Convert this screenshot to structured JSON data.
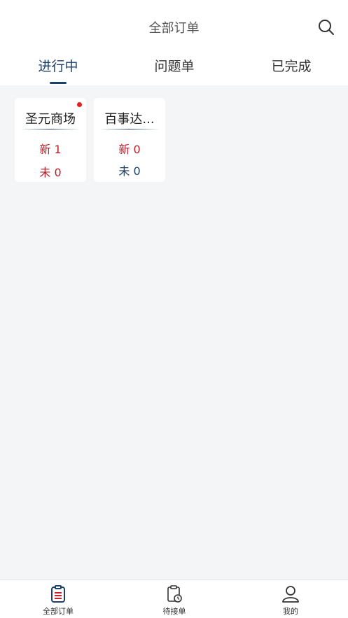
{
  "header": {
    "title": "全部订单"
  },
  "tabs": [
    {
      "label": "进行中"
    },
    {
      "label": "问题单"
    },
    {
      "label": "已完成"
    }
  ],
  "stores": [
    {
      "name": "圣元商场",
      "new_label": "新 1",
      "pending_label": "未 0",
      "has_dot": true,
      "pending_color": "#b8202a"
    },
    {
      "name": "百事达...",
      "new_label": "新 0",
      "pending_label": "未 0",
      "has_dot": false,
      "pending_color": "#1c3f6b"
    }
  ],
  "tabbar": [
    {
      "label": "全部订单",
      "icon": "clipboard-list-icon"
    },
    {
      "label": "待接单",
      "icon": "clipboard-clock-icon"
    },
    {
      "label": "我的",
      "icon": "user-icon"
    }
  ],
  "colors": {
    "accent": "#1c3f6b",
    "new_count": "#b8202a",
    "dot": "#e0201c"
  }
}
